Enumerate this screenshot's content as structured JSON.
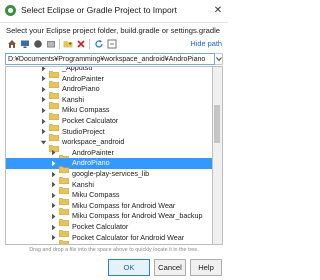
{
  "window": {
    "title": "Select Eclipse or Gradle Project to Import",
    "close_glyph": "✕"
  },
  "instruction": "Select your Eclipse project folder, build.gradle or settings.gradle",
  "toolbar": {
    "icons": [
      "home-icon",
      "desktop-icon",
      "project-icon",
      "module-icon",
      "new-folder-icon",
      "delete-icon",
      "refresh-icon",
      "show-hidden-icon"
    ],
    "hide_path_label": "Hide path"
  },
  "path": {
    "value": "D:¥Documents¥Programming¥workspace_android¥AndroPiano"
  },
  "tree": {
    "rows": [
      {
        "label": "_Apputsu",
        "selected": false
      },
      {
        "label": "AndroPainter",
        "selected": false
      },
      {
        "label": "AndroPiano",
        "selected": false
      },
      {
        "label": "Kanshi",
        "selected": false
      },
      {
        "label": "Miku Compass",
        "selected": false
      },
      {
        "label": "Pocket Calculator",
        "selected": false
      },
      {
        "label": "StudioProject",
        "selected": false
      },
      {
        "label": "workspace_android",
        "selected": false
      },
      {
        "label": "AndroPainter",
        "selected": false
      },
      {
        "label": "AndroPiano",
        "selected": true
      },
      {
        "label": "google-play-services_lib",
        "selected": false
      },
      {
        "label": "Kanshi",
        "selected": false
      },
      {
        "label": "Miku Compass",
        "selected": false
      },
      {
        "label": "Miku Compass for Android Wear",
        "selected": false
      },
      {
        "label": "Miku Compass for Android Wear_backup",
        "selected": false
      },
      {
        "label": "Pocket Calculator",
        "selected": false
      },
      {
        "label": "Pocket Calculator for Android Wear",
        "selected": false
      }
    ]
  },
  "hint": "Drag and drop a file into the space above to quickly locate it in the tree.",
  "buttons": {
    "ok": "OK",
    "cancel": "Cancel",
    "help": "Help"
  },
  "colors": {
    "selection": "#3399ff",
    "folder": "#e8c35a",
    "accent": "#1a66c8"
  }
}
